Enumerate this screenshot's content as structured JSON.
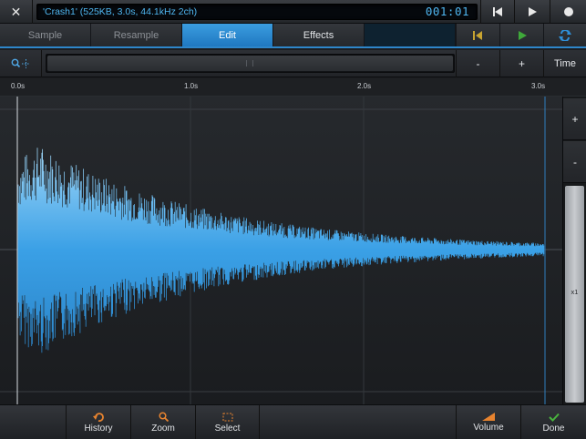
{
  "topbar": {
    "sample_info": "'Crash1' (525KB, 3.0s, 44.1kHz 2ch)",
    "counter": "001:01"
  },
  "tabs": [
    {
      "label": "Sample"
    },
    {
      "label": "Resample"
    },
    {
      "label": "Edit"
    },
    {
      "label": "Effects"
    }
  ],
  "active_tab": "Edit",
  "zoombar": {
    "minus_label": "-",
    "plus_label": "+",
    "time_label": "Time"
  },
  "timeline": {
    "ticks": [
      "0.0s",
      "1.0s",
      "2.0s",
      "3.0s"
    ]
  },
  "vzoom": {
    "plus_label": "+",
    "minus_label": "-",
    "scale_label": "x1"
  },
  "toolbar": {
    "history_label": "History",
    "zoom_label": "Zoom",
    "select_label": "Select",
    "volume_label": "Volume",
    "done_label": "Done"
  },
  "icons": {
    "close": "close-icon",
    "rewind": "skip-to-start-icon",
    "play": "play-icon",
    "record": "record-icon",
    "loop_start": "loop-start-icon",
    "loop_play": "loop-play-icon",
    "loop_toggle": "loop-toggle-icon",
    "zoom_tool": "zoom-tool-icon",
    "history": "undo-icon",
    "zoom": "magnifier-icon",
    "select": "selection-icon",
    "volume": "volume-ramp-icon",
    "done": "checkmark-icon"
  },
  "colors": {
    "accent": "#2e86c9",
    "waveform": "#43a7ea",
    "lcd_text": "#4fb6f0",
    "loop_start": "#c8a431",
    "loop_play": "#3fa83a",
    "history_icon": "#e7832f",
    "done_icon": "#49b43e"
  }
}
